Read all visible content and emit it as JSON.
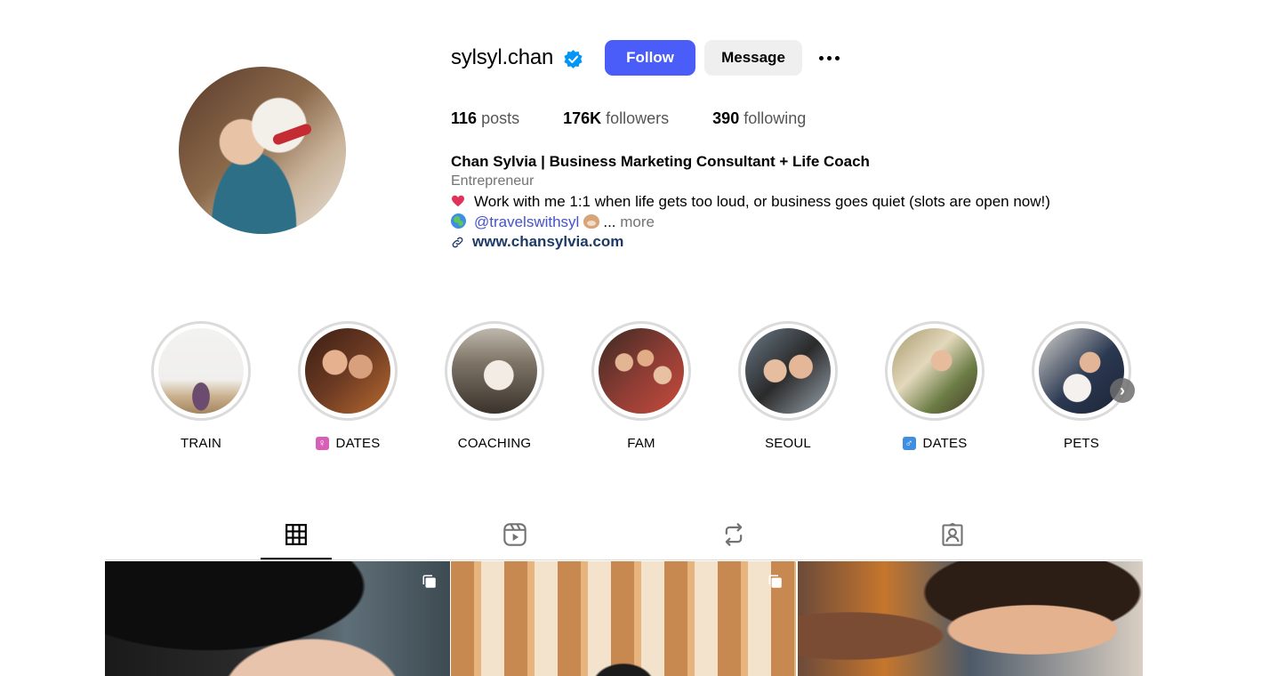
{
  "profile": {
    "username": "sylsyl.chan",
    "verified_icon": "verified-badge-icon",
    "follow_label": "Follow",
    "message_label": "Message",
    "more_icon": "more-options-icon"
  },
  "stats": {
    "posts_count": "116",
    "posts_label": "posts",
    "followers_count": "176K",
    "followers_label": "followers",
    "following_count": "390",
    "following_label": "following"
  },
  "bio": {
    "name": "Chan Sylvia | Business Marketing Consultant + Life Coach",
    "category": "Entrepreneur",
    "line1": "Work with me 1:1 when life gets too loud, or business goes quiet (slots are open now!)",
    "mention": "@travelswithsyl",
    "ellipsis": "...",
    "more_label": "more",
    "link": "www.chansylvia.com"
  },
  "highlights": [
    {
      "label": "TRAIN",
      "symbol": ""
    },
    {
      "label": "DATES",
      "symbol": "♀"
    },
    {
      "label": "COACHING",
      "symbol": ""
    },
    {
      "label": "FAM",
      "symbol": ""
    },
    {
      "label": "SEOUL",
      "symbol": ""
    },
    {
      "label": "DATES",
      "symbol": "♂"
    },
    {
      "label": "PETS",
      "symbol": ""
    }
  ],
  "tabs": [
    {
      "name": "posts-grid-icon",
      "active": true
    },
    {
      "name": "reels-icon",
      "active": false
    },
    {
      "name": "reposts-icon",
      "active": false
    },
    {
      "name": "tagged-icon",
      "active": false
    }
  ],
  "colors": {
    "follow_button": "#4a5df9",
    "message_button": "#efefef",
    "verified": "#0095f6",
    "link": "#1d3a66",
    "mention": "#4553c9"
  }
}
